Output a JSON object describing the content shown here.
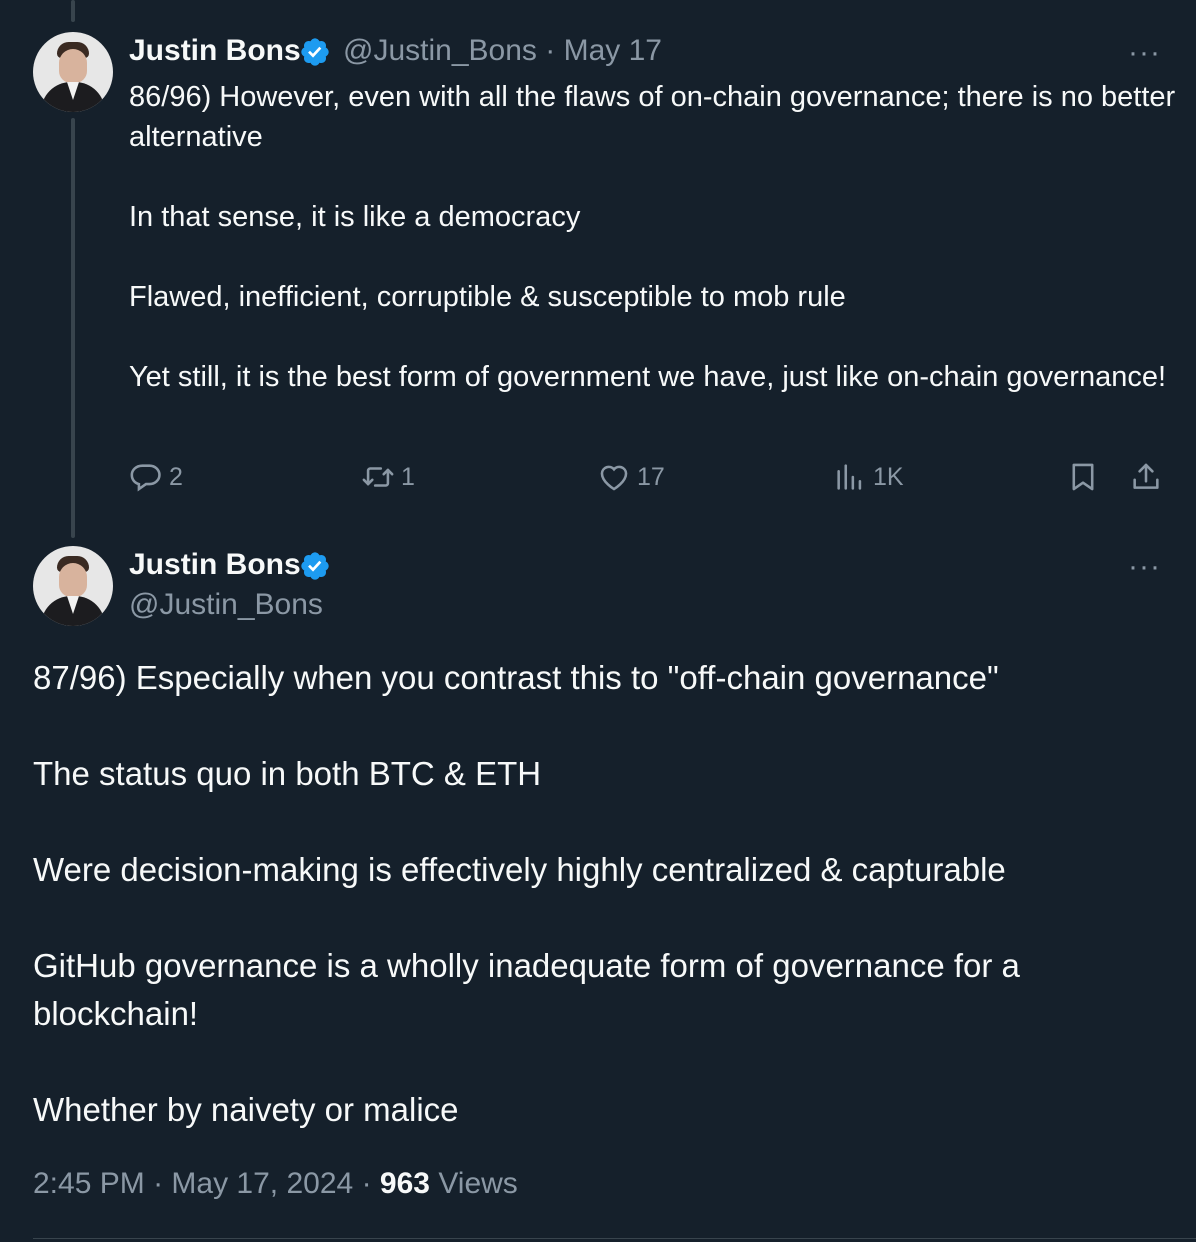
{
  "tweet1": {
    "name": "Justin Bons",
    "handle": "@Justin_Bons",
    "separator": "·",
    "date": "May 17",
    "more": "···",
    "paragraphs": [
      "86/96) However, even with all the flaws of on-chain governance; there is no better alternative",
      "In that sense, it is like a democracy",
      "Flawed, inefficient, corruptible & susceptible to mob rule",
      "Yet still, it is the best form of government we have, just like on-chain governance!"
    ],
    "actions": {
      "replies": "2",
      "reposts": "1",
      "likes": "17",
      "views": "1K"
    }
  },
  "tweet2": {
    "name": "Justin Bons",
    "handle": "@Justin_Bons",
    "more": "···",
    "paragraphs": [
      "87/96) Especially when you contrast this to \"off-chain governance\"",
      "The status quo in both BTC & ETH",
      "Were decision-making is effectively highly centralized & capturable",
      "GitHub governance is a wholly inadequate form of governance for a blockchain!",
      "Whether by naivety or malice"
    ],
    "time": "2:45 PM",
    "sep1": "·",
    "full_date": "May 17, 2024",
    "sep2": "·",
    "views_count": "963",
    "views_label": "Views"
  },
  "colors": {
    "background": "#15202b",
    "text": "#f7f9f9",
    "muted": "#8b98a5",
    "verified": "#1d9bf0",
    "thread_line": "#38444d"
  },
  "icons": [
    "verified-badge-icon",
    "more-icon",
    "reply-icon",
    "repost-icon",
    "like-icon",
    "views-icon",
    "bookmark-icon",
    "share-icon"
  ]
}
